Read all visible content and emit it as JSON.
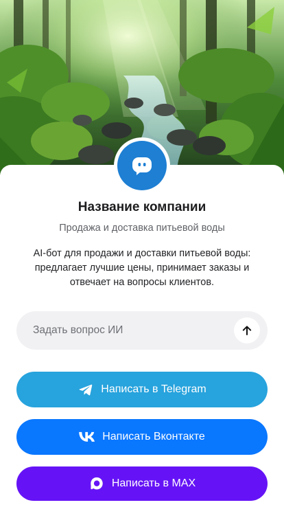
{
  "company": {
    "name": "Название компании",
    "tagline": "Продажа и доставка питьевой воды",
    "description": "AI-бот для продажи и доставки питьевой воды: предлагает лучшие цены, принимает заказы и отвечает на вопросы клиентов."
  },
  "ask": {
    "placeholder": "Задать вопрос ИИ",
    "value": ""
  },
  "actions": {
    "telegram": {
      "label": "Написать в Telegram",
      "icon": "telegram-icon",
      "color": "#27a3dd"
    },
    "vk": {
      "label": "Написать Вконтакте",
      "icon": "vk-icon",
      "color": "#0a77ff"
    },
    "max": {
      "label": "Написать в MAX",
      "icon": "max-icon",
      "color": "#6513f6"
    }
  },
  "avatar": {
    "icon": "chat-bot-icon",
    "color": "#1e7fd3"
  },
  "colors": {
    "title": "#1d1d1f",
    "subtitle": "#5f6166",
    "input_bg": "#f1f1f3"
  }
}
